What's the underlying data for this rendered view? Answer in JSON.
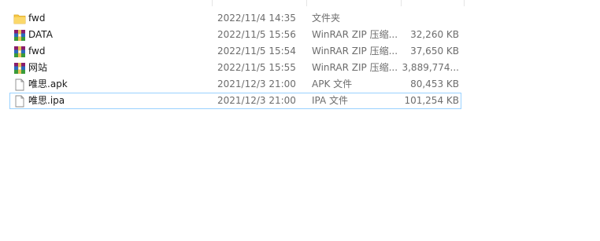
{
  "colors": {
    "folder_yellow": "#f7c948",
    "focus_border": "#99d1ff",
    "secondary_text": "#6d6d6d"
  },
  "files": [
    {
      "name": "fwd",
      "date": "2022/11/4 14:35",
      "type": "文件夹",
      "size": "",
      "icon": "folder-icon"
    },
    {
      "name": "DATA",
      "date": "2022/11/5 15:56",
      "type": "WinRAR ZIP 压缩...",
      "size": "32,260 KB",
      "icon": "winrar-archive-icon"
    },
    {
      "name": "fwd",
      "date": "2022/11/5 15:54",
      "type": "WinRAR ZIP 压缩...",
      "size": "37,650 KB",
      "icon": "winrar-archive-icon"
    },
    {
      "name": "网站",
      "date": "2022/11/5 15:55",
      "type": "WinRAR ZIP 压缩...",
      "size": "3,889,774...",
      "icon": "winrar-archive-icon"
    },
    {
      "name": "唯思.apk",
      "date": "2021/12/3 21:00",
      "type": "APK 文件",
      "size": "80,453 KB",
      "icon": "file-icon"
    },
    {
      "name": "唯思.ipa",
      "date": "2021/12/3 21:00",
      "type": "IPA 文件",
      "size": "101,254 KB",
      "icon": "file-icon"
    }
  ]
}
